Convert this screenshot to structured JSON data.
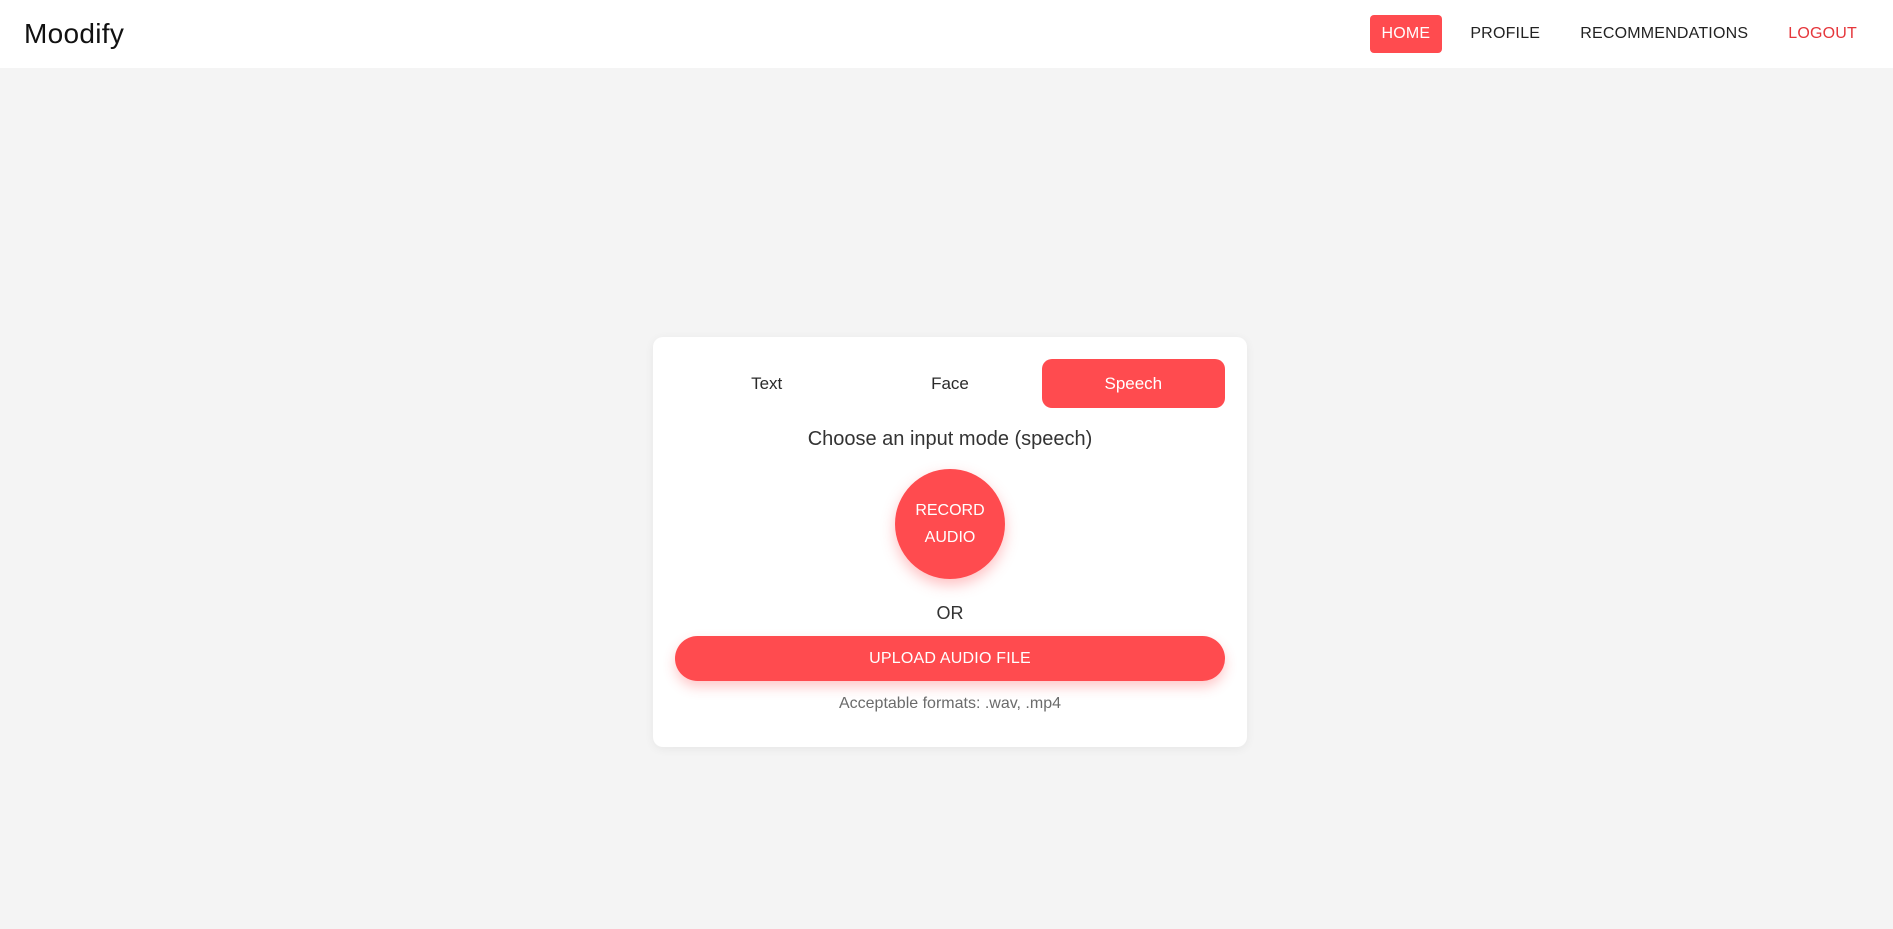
{
  "navbar": {
    "brand": "Moodify",
    "links": [
      {
        "label": "HOME",
        "active": true
      },
      {
        "label": "PROFILE",
        "active": false
      },
      {
        "label": "RECOMMENDATIONS",
        "active": false
      },
      {
        "label": "LOGOUT",
        "active": false
      }
    ]
  },
  "card": {
    "tabs": [
      {
        "label": "Text",
        "active": false
      },
      {
        "label": "Face",
        "active": false
      },
      {
        "label": "Speech",
        "active": true
      }
    ],
    "prompt": "Choose an input mode (speech)",
    "record_label": "RECORD AUDIO",
    "or_label": "OR",
    "upload_label": "UPLOAD AUDIO FILE",
    "formats_text": "Acceptable formats: .wav, .mp4"
  },
  "colors": {
    "accent": "#ff4b4f",
    "logout": "#e5363b",
    "background": "#f4f4f4"
  }
}
